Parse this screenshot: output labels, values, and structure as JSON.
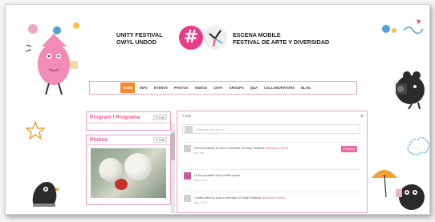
{
  "header": {
    "left_logo_line1": "UNITY FESTIVAL",
    "left_logo_line2": "GWYL UNDOD",
    "hash_symbol": "#",
    "right_logo_line1": "ESCENA MOBILE",
    "right_logo_line2": "FESTIVAL DE ARTE Y DIVERSIDAD"
  },
  "nav": {
    "items": [
      "HOME",
      "INFO",
      "EVENTS",
      "PHOTOS",
      "VIDEOS",
      "CHAT",
      "GROUPS",
      "Q&A",
      "COLLABORATORS",
      "BLOG"
    ],
    "active_index": 0
  },
  "left_panel": {
    "program_title": "Program / Programa",
    "program_edit": "✎ Edit",
    "photos_title": "Photos",
    "photos_edit": "✎ Edit"
  },
  "feed": {
    "edit_label": "✎ Edit",
    "close_label": "×",
    "post_placeholder": "What are you up to?",
    "posting_button": "Posting",
    "items": [
      {
        "text_plain": "Gemma Bryan is now a member of Unity Festival",
        "link": "Welcome Them!",
        "time": "6h 1 min"
      },
      {
        "text_plain": "Hi Ed updated their profile photo",
        "link": "",
        "time": "May 1 2014"
      },
      {
        "text_plain": "Cristina Bird is now a member of Unity Festival",
        "link": "Welcome Them!",
        "time": "May 1 2014"
      }
    ]
  },
  "colors": {
    "accent_pink": "#e74d8e",
    "nav_active": "#f08a2a",
    "panel_border": "#ef9fc3"
  }
}
